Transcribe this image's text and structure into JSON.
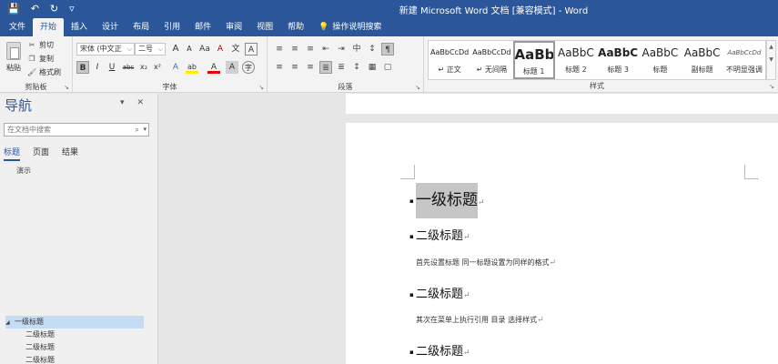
{
  "quick_access": {
    "save_icon": "💾",
    "undo_icon": "↶",
    "redo_icon": "↻",
    "more_icon": "▿"
  },
  "window": {
    "title": "新建 Microsoft Word 文档 [兼容模式] - Word"
  },
  "tabs": [
    {
      "label": "文件"
    },
    {
      "label": "开始"
    },
    {
      "label": "插入"
    },
    {
      "label": "设计"
    },
    {
      "label": "布局"
    },
    {
      "label": "引用"
    },
    {
      "label": "邮件"
    },
    {
      "label": "审阅"
    },
    {
      "label": "视图"
    },
    {
      "label": "帮助"
    }
  ],
  "tell_me": "操作说明搜索",
  "clipboard": {
    "paste": "粘贴",
    "cut": "剪切",
    "copy": "复制",
    "format_painter": "格式刷",
    "label": "剪贴板"
  },
  "font": {
    "name": "宋体 (中文正",
    "size": "二号",
    "grow": "A",
    "shrink": "A",
    "case": "Aa",
    "clear": "A",
    "phonetic": "文",
    "border": "A",
    "bold": "B",
    "italic": "I",
    "underline": "U",
    "strike": "abc",
    "sub": "x₂",
    "sup": "x²",
    "effects": "A",
    "highlight": "ab",
    "color": "A",
    "shade": "A",
    "circle": "字",
    "label": "字体"
  },
  "paragraph": {
    "label": "段落",
    "row1": [
      "≡",
      "≡",
      "≡",
      "⇤",
      "⇥",
      "中",
      "↕",
      "¶"
    ],
    "row2": [
      "≡",
      "≡",
      "≡",
      "≣",
      "≣",
      "↕",
      "▦",
      "▢"
    ]
  },
  "styles": {
    "label": "样式",
    "items": [
      {
        "preview": "AaBbCcDd",
        "name": "↵ 正文"
      },
      {
        "preview": "AaBbCcDd",
        "name": "↵ 无间隔"
      },
      {
        "preview": "AaBb",
        "name": "标题 1"
      },
      {
        "preview": "AaBbC",
        "name": "标题 2"
      },
      {
        "preview": "AaBbC",
        "name": "标题 3"
      },
      {
        "preview": "AaBbC",
        "name": "标题"
      },
      {
        "preview": "AaBbC",
        "name": "副标题"
      },
      {
        "preview": "AaBbCcDd",
        "name": "不明显强调"
      }
    ]
  },
  "nav": {
    "title": "导航",
    "search_placeholder": "在文档中搜索",
    "tabs": [
      "标题",
      "页面",
      "结果"
    ],
    "demo": "演示",
    "tree": [
      {
        "label": "一级标题",
        "level": 1
      },
      {
        "label": "二级标题",
        "level": 2
      },
      {
        "label": "二级标题",
        "level": 2
      },
      {
        "label": "二级标题",
        "level": 2
      }
    ]
  },
  "document": {
    "h1": "一级标题",
    "h2_1": "二级标题",
    "p1": "首先设置标题 同一标题设置为同样的格式",
    "h2_2": "二级标题",
    "p2": "其次在菜单上执行引用 目录 选择样式",
    "h2_3": "二级标题",
    "para_mark": "↵"
  },
  "colors": {
    "brand": "#2b579a",
    "highlight": "#c6c6c6",
    "nav_selected": "#c5dcf5"
  }
}
